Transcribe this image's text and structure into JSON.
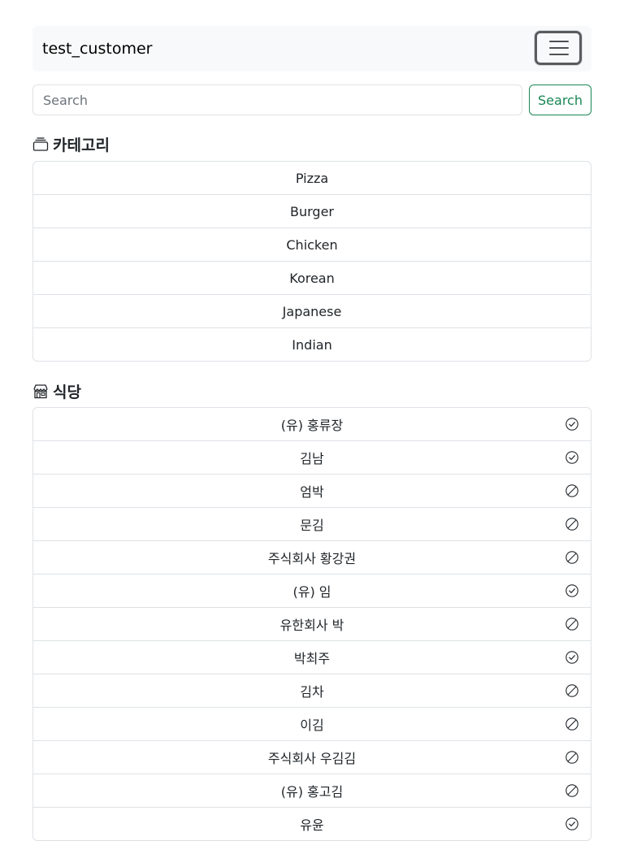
{
  "navbar": {
    "brand": "test_customer",
    "toggle_icon": "hamburger-menu-icon"
  },
  "search": {
    "placeholder": "Search",
    "button_label": "Search",
    "button_color": "#198754"
  },
  "categories": {
    "title": "카테고리",
    "icon": "stack-icon",
    "items": [
      "Pizza",
      "Burger",
      "Chicken",
      "Korean",
      "Japanese",
      "Indian"
    ]
  },
  "restaurants": {
    "title": "식당",
    "icon": "shop-icon",
    "items": [
      {
        "name": "(유) 홍류장",
        "status": "check-circle-icon"
      },
      {
        "name": "김남",
        "status": "check-circle-icon"
      },
      {
        "name": "엄박",
        "status": "slash-circle-icon"
      },
      {
        "name": "문김",
        "status": "slash-circle-icon"
      },
      {
        "name": "주식회사 황강권",
        "status": "slash-circle-icon"
      },
      {
        "name": "(유) 임",
        "status": "check-circle-icon"
      },
      {
        "name": "유한회사 박",
        "status": "slash-circle-icon"
      },
      {
        "name": "박최주",
        "status": "check-circle-icon"
      },
      {
        "name": "김차",
        "status": "slash-circle-icon"
      },
      {
        "name": "이김",
        "status": "slash-circle-icon"
      },
      {
        "name": "주식회사 우김김",
        "status": "slash-circle-icon"
      },
      {
        "name": "(유) 홍고김",
        "status": "slash-circle-icon"
      },
      {
        "name": "유윤",
        "status": "check-circle-icon"
      }
    ]
  }
}
